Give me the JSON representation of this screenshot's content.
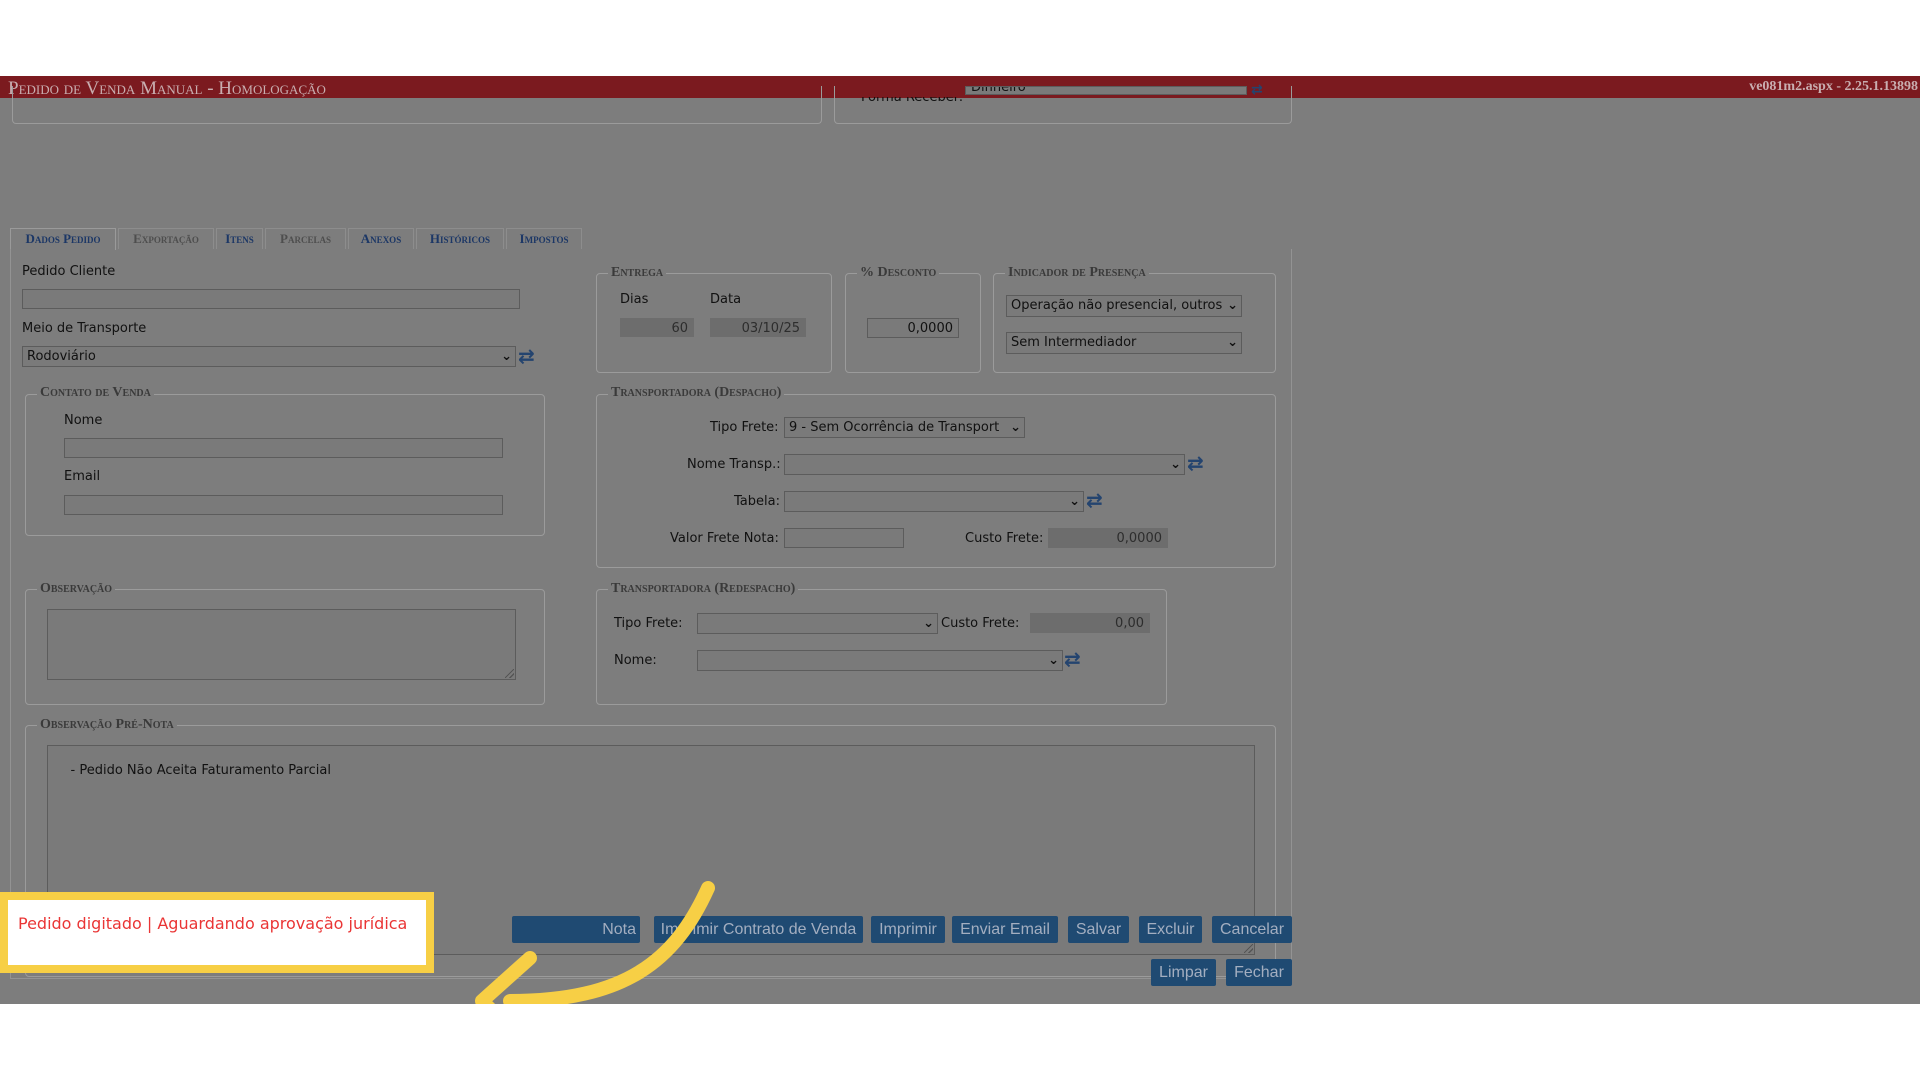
{
  "window": {
    "title": "Pedido de Venda Manual - Homologação",
    "version": "ve081m2.aspx - 2.25.1.13898"
  },
  "top_fragment": {
    "label": "Forma Receber:",
    "value": "Dinheiro"
  },
  "tabs": [
    {
      "label": "Dados Pedido",
      "state": "active"
    },
    {
      "label": "Exportação",
      "state": "disabled"
    },
    {
      "label": "Itens",
      "state": "enabled"
    },
    {
      "label": "Parcelas",
      "state": "disabled"
    },
    {
      "label": "Anexos",
      "state": "enabled"
    },
    {
      "label": "Históricos",
      "state": "enabled"
    },
    {
      "label": "Impostos",
      "state": "enabled"
    }
  ],
  "pedido_cliente": {
    "label": "Pedido Cliente",
    "value": ""
  },
  "meio_transporte": {
    "label": "Meio de Transporte",
    "value": "Rodoviário"
  },
  "contato_venda": {
    "legend": "Contato de Venda",
    "nome_label": "Nome",
    "nome_value": "",
    "email_label": "Email",
    "email_value": ""
  },
  "observacao": {
    "legend": "Observação",
    "value": ""
  },
  "observacao_pre_nota": {
    "legend": "Observação Pré-Nota",
    "value": "- Pedido Não Aceita Faturamento Parcial"
  },
  "entrega": {
    "legend": "Entrega",
    "dias_label": "Dias",
    "dias_value": "60",
    "data_label": "Data",
    "data_value": "03/10/25"
  },
  "desconto": {
    "legend": "% Desconto",
    "value": "0,0000"
  },
  "indicador_presenca": {
    "legend": "Indicador de Presença",
    "select1": "Operação não presencial, outros",
    "select2": "Sem Intermediador"
  },
  "transp_despacho": {
    "legend": "Transportadora (Despacho)",
    "tipo_frete_label": "Tipo Frete:",
    "tipo_frete_value": "9 - Sem Ocorrência de Transport",
    "nome_label": "Nome Transp.:",
    "nome_value": "",
    "tabela_label": "Tabela:",
    "tabela_value": "",
    "valor_frete_label": "Valor Frete Nota:",
    "valor_frete_value": "",
    "custo_frete_label": "Custo Frete:",
    "custo_frete_value": "0,0000"
  },
  "transp_redespacho": {
    "legend": "Transportadora (Redespacho)",
    "tipo_frete_label": "Tipo Frete:",
    "tipo_frete_value": "",
    "custo_frete_label": "Custo Frete:",
    "custo_frete_value": "0,00",
    "nome_label": "Nome:",
    "nome_value": ""
  },
  "buttons": {
    "partial": "Nota",
    "imprimir_contrato": "Imprimir Contrato de Venda",
    "imprimir": "Imprimir",
    "enviar_email": "Enviar Email",
    "salvar": "Salvar",
    "excluir": "Excluir",
    "cancelar": "Cancelar",
    "limpar": "Limpar",
    "fechar": "Fechar"
  },
  "status": {
    "text": "Pedido digitado | Aguardando aprovação jurídica"
  },
  "colors": {
    "titlebar": "#7b1a1f",
    "button": "#1f4a72",
    "highlight": "#f7cf45",
    "status_text": "#ea3535",
    "arrow": "#f7cf45"
  }
}
